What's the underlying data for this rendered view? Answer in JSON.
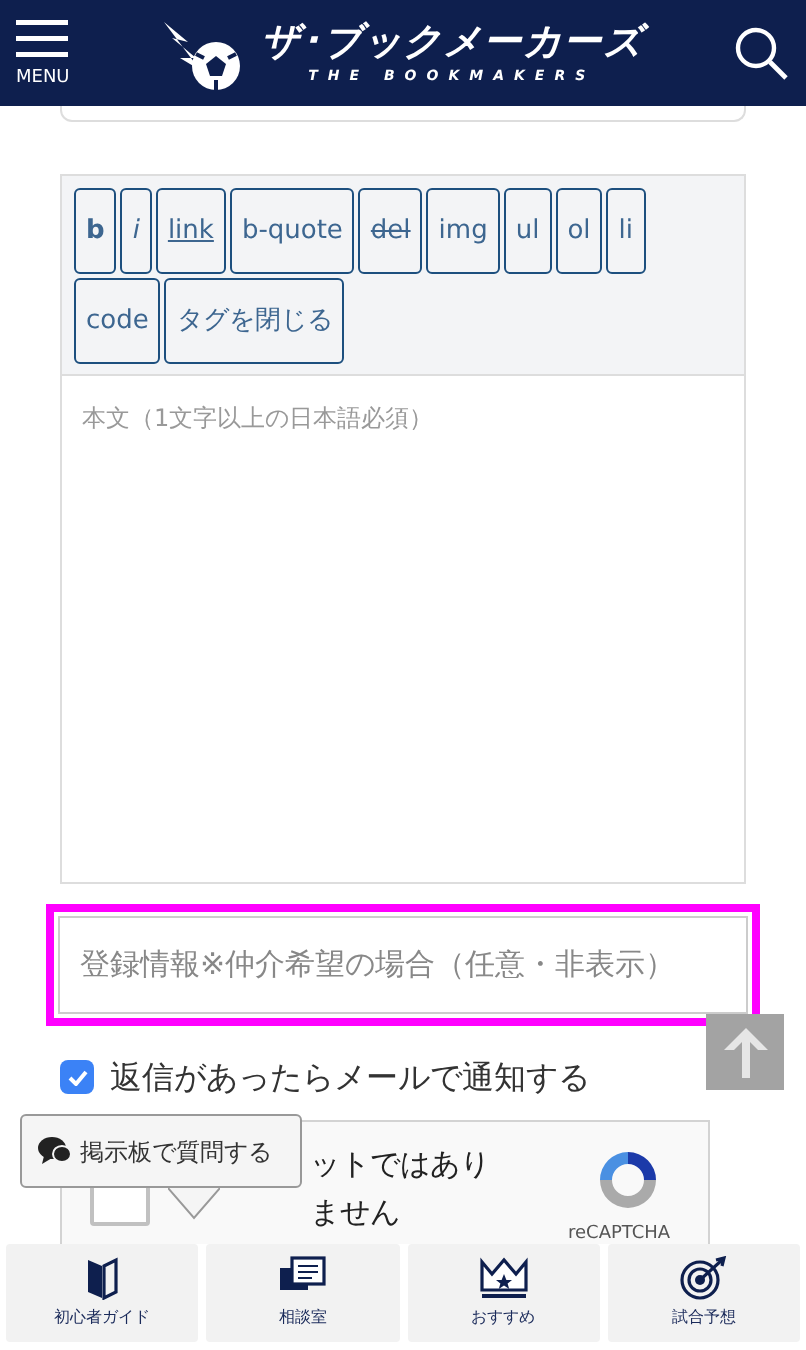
{
  "header": {
    "menu_label": "MENU",
    "logo_title": "ザ･ブックメーカーズ",
    "logo_subtitle": "THE BOOKMAKERS"
  },
  "toolbar": {
    "buttons": [
      {
        "label": "b",
        "kind": "bold"
      },
      {
        "label": "i",
        "kind": "italic"
      },
      {
        "label": "link",
        "kind": "underline"
      },
      {
        "label": "b-quote",
        "kind": "plain"
      },
      {
        "label": "del",
        "kind": "strike"
      },
      {
        "label": "img",
        "kind": "plain"
      },
      {
        "label": "ul",
        "kind": "plain"
      },
      {
        "label": "ol",
        "kind": "plain"
      },
      {
        "label": "li",
        "kind": "plain"
      },
      {
        "label": "code",
        "kind": "plain"
      },
      {
        "label": "タグを閉じる",
        "kind": "plain"
      }
    ]
  },
  "body_field": {
    "placeholder": "本文（1文字以上の日本語必須）"
  },
  "registration_field": {
    "placeholder": "登録情報※仲介希望の場合（任意・非表示）"
  },
  "notify": {
    "label": "返信があったらメールで通知する",
    "checked": true
  },
  "captcha": {
    "checked": false,
    "label_lines": [
      "ットではあり",
      "ません"
    ],
    "brand": "reCAPTCHA"
  },
  "tooltip": {
    "label": "掲示板で質問する"
  },
  "bottom_nav": [
    {
      "label": "初心者ガイド",
      "kind": "guide"
    },
    {
      "label": "相談室",
      "kind": "chat"
    },
    {
      "label": "おすすめ",
      "kind": "crown"
    },
    {
      "label": "試合予想",
      "kind": "target"
    }
  ]
}
